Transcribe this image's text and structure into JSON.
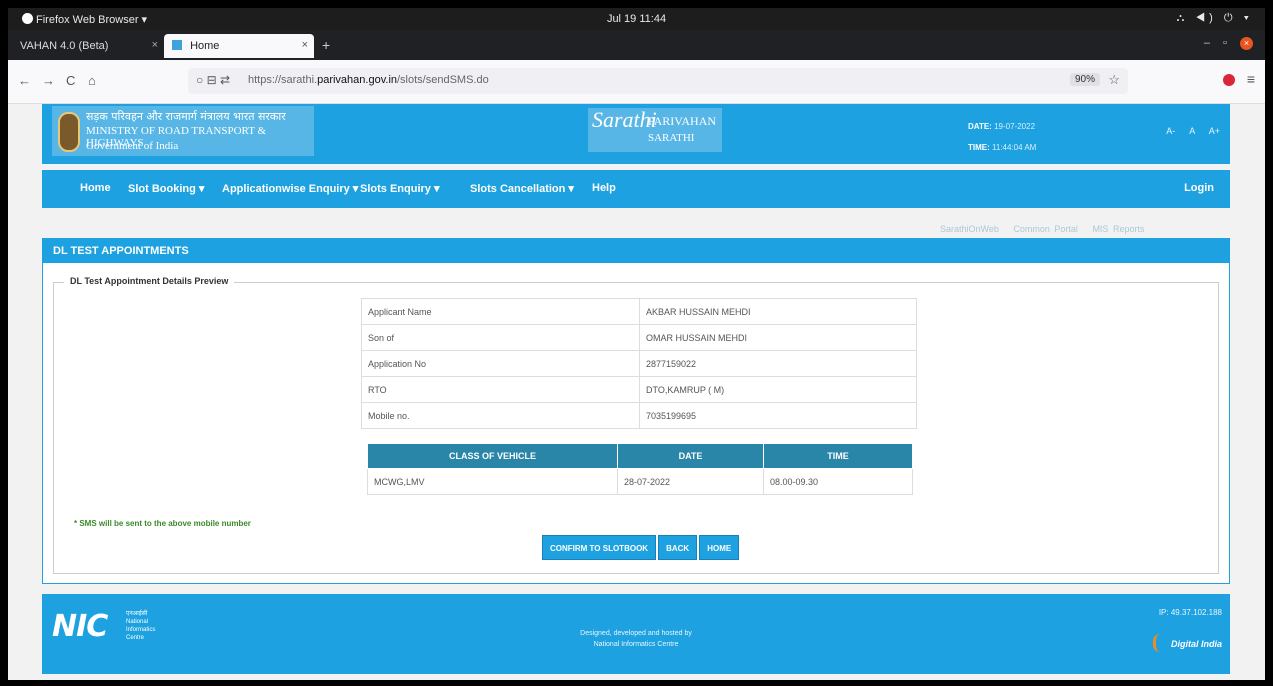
{
  "os": {
    "app_name": "Firefox Web Browser ▾",
    "clock": "Jul 19  11:44",
    "tray": "⛬ ◀) ⏻ ▾"
  },
  "tabs": [
    {
      "label": "VAHAN 4.0 (Beta)"
    },
    {
      "label": "Home"
    }
  ],
  "tab_close": "×",
  "tab_new": "+",
  "window_controls": {
    "minimize": "–",
    "maximize": "▫",
    "close": "×"
  },
  "nav": {
    "back": "←",
    "forward": "→",
    "reload": "C",
    "home": "⌂",
    "url_prefix": "https://sarathi.",
    "url_domain": "parivahan.gov.in",
    "url_path": "/slots/sendSMS.do",
    "zoom": "90%",
    "bookmark": "☆",
    "menu": "≡",
    "shield": "○ ⊟ ⇄"
  },
  "banner": {
    "hindi": "सड़क परिवहन और राजमार्ग मंत्रालय भारत सरकार",
    "ministry": "MINISTRY OF ROAD TRANSPORT & HIGHWAYS",
    "govt": "Government of India",
    "logo_text": "Sarathi",
    "brand_1": "PARIVAHAN",
    "brand_2": "SARATHI",
    "date_label": "DATE:",
    "date_value": "19-07-2022",
    "time_label": "TIME:",
    "time_value": "11:44:04 AM",
    "font_sizes": "A- A A+"
  },
  "menu": [
    {
      "label": "Home"
    },
    {
      "label": "Slot Booking ▾"
    },
    {
      "label": "Applicationwise Enquiry ▾"
    },
    {
      "label": "Slots Enquiry ▾"
    },
    {
      "label": "Slots Cancellation ▾"
    },
    {
      "label": "Help"
    }
  ],
  "login": "Login",
  "toplinks": [
    "SarathiOnWeb",
    "Common Portal",
    "MIS Reports"
  ],
  "panel": {
    "title": "DL TEST APPOINTMENTS",
    "legend": "DL Test Appointment Details Preview",
    "details": [
      {
        "label": "Applicant Name",
        "value": "AKBAR HUSSAIN MEHDI"
      },
      {
        "label": "Son of",
        "value": "OMAR HUSSAIN MEHDI"
      },
      {
        "label": "Application No",
        "value": "2877159022"
      },
      {
        "label": "RTO",
        "value": "DTO,KAMRUP ( M)"
      },
      {
        "label": "Mobile no.",
        "value": "7035199695"
      }
    ],
    "slot_headers": [
      "CLASS OF VEHICLE",
      "DATE",
      "TIME"
    ],
    "slot_row": {
      "cov": "MCWG,LMV",
      "date": "28-07-2022",
      "time": "08.00-09.30"
    },
    "note": "* SMS will be sent to the above mobile number",
    "buttons": {
      "confirm": "CONFIRM TO SLOTBOOK",
      "back": "BACK",
      "home": "HOME"
    }
  },
  "footer": {
    "nic_mark": "NIC",
    "nic_hindi": "एनआईसी",
    "nic_sub_1": "National",
    "nic_sub_2": "Informatics",
    "nic_sub_3": "Centre",
    "designed": "Designed, developed and hosted by",
    "by": "National Informatics Centre",
    "ip": "IP: 49.37.102.188",
    "digital_india": "Digital India"
  }
}
